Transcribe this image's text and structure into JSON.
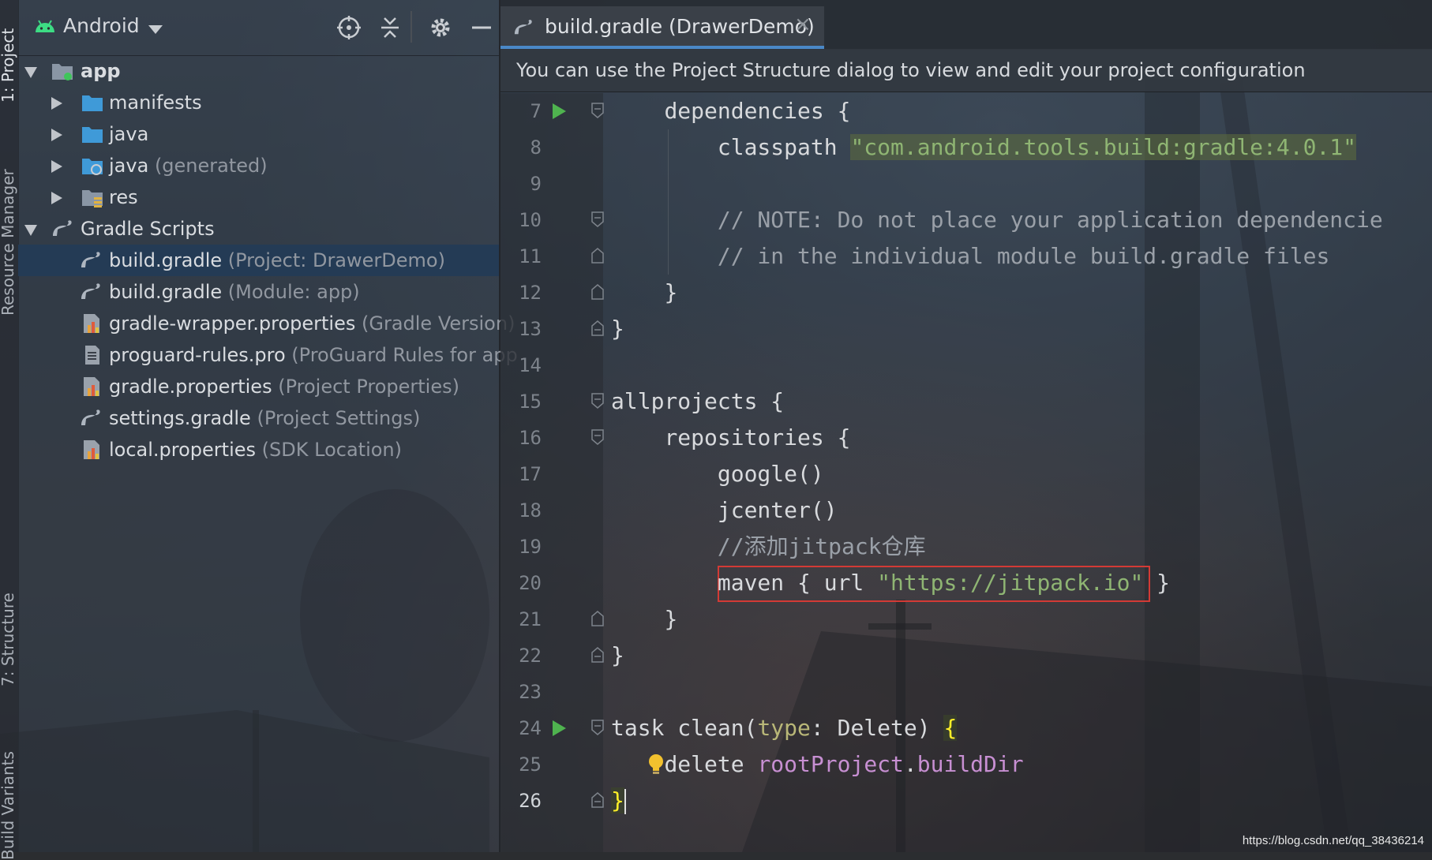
{
  "side_tabs": {
    "project": "1: Project",
    "resource_manager": "Resource Manager",
    "structure": "7: Structure",
    "build_variants": "Build Variants"
  },
  "project_panel": {
    "view_label": "Android",
    "toolbar_icons": [
      "locate-icon",
      "collapse-all-icon",
      "gear-icon",
      "minimize-icon"
    ],
    "tree": [
      {
        "label": "app",
        "hint": "",
        "icon": "module-folder-icon",
        "expanded": true
      },
      {
        "label": "manifests",
        "hint": "",
        "icon": "folder-icon",
        "expanded": false
      },
      {
        "label": "java",
        "hint": "",
        "icon": "folder-icon",
        "expanded": false
      },
      {
        "label": "java",
        "hint": "(generated)",
        "icon": "generated-folder-icon",
        "expanded": false
      },
      {
        "label": "res",
        "hint": "",
        "icon": "resource-folder-icon",
        "expanded": false
      },
      {
        "label": "Gradle Scripts",
        "hint": "",
        "icon": "gradle-icon",
        "expanded": true
      },
      {
        "label": "build.gradle",
        "hint": "(Project: DrawerDemo)",
        "icon": "gradle-icon",
        "selected": true
      },
      {
        "label": "build.gradle",
        "hint": "(Module: app)",
        "icon": "gradle-icon"
      },
      {
        "label": "gradle-wrapper.properties",
        "hint": "(Gradle Version)",
        "icon": "properties-icon"
      },
      {
        "label": "proguard-rules.pro",
        "hint": "(ProGuard Rules for app",
        "icon": "text-file-icon"
      },
      {
        "label": "gradle.properties",
        "hint": "(Project Properties)",
        "icon": "properties-icon"
      },
      {
        "label": "settings.gradle",
        "hint": "(Project Settings)",
        "icon": "gradle-icon"
      },
      {
        "label": "local.properties",
        "hint": "(SDK Location)",
        "icon": "properties-icon"
      }
    ]
  },
  "editor": {
    "tab_label": "build.gradle (DrawerDemo)",
    "tab_close": "×",
    "notice": "You can use the Project Structure dialog to view and edit your project configuration",
    "line_numbers": [
      "7",
      "8",
      "9",
      "10",
      "11",
      "12",
      "13",
      "14",
      "15",
      "16",
      "17",
      "18",
      "19",
      "20",
      "21",
      "22",
      "23",
      "24",
      "25",
      "26"
    ],
    "code": {
      "l7": "dependencies {",
      "l8_kw": "classpath ",
      "l8_str": "\"com.android.tools.build:gradle:4.0.1\"",
      "l10": "// NOTE: Do not place your application dependencie",
      "l11": "// in the individual module build.gradle files",
      "l12": "}",
      "l13": "}",
      "l15": "allprojects {",
      "l16": "repositories {",
      "l17": "google()",
      "l18": "jcenter()",
      "l19": "//添加jitpack仓库",
      "l20_a": "maven { url ",
      "l20_str": "\"https://jitpack.io\"",
      "l20_b": " }",
      "l21": "}",
      "l22": "}",
      "l24_a": "task clean(",
      "l24_param": "type",
      "l24_b": ": Delete) ",
      "l24_brace": "{",
      "l25_a": "delete ",
      "l25_prop": "rootProject",
      "l25_b": ".",
      "l25_prop2": "buildDir",
      "l26_brace": "}"
    }
  },
  "watermark": "https://blog.csdn.net/qq_38436214",
  "colors": {
    "selection": "#243b55",
    "tab_underline": "#4a88c7",
    "string": "#8fb573",
    "highlight_box": "#d33a35",
    "run_icon": "#4fb34f"
  }
}
